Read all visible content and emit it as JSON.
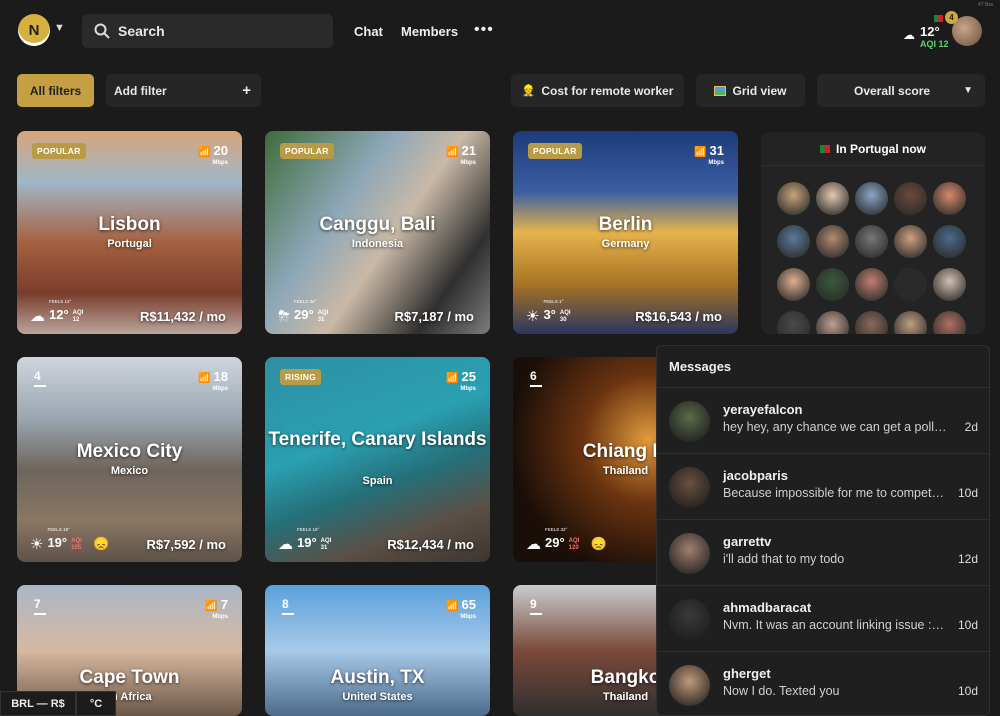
{
  "header": {
    "search_placeholder": "Search",
    "nav": [
      "Chat",
      "Members"
    ],
    "more": "•••",
    "weather": {
      "temp": "12°",
      "aqi": "AQI 12",
      "icon": "cloud-sun-icon"
    },
    "notification_count": "4",
    "sys_info": "47 Bss"
  },
  "filters": {
    "all_label": "All filters",
    "add_label": "Add filter",
    "add_icon": "+",
    "cost_label": "Cost for remote worker",
    "grid_label": "Grid view",
    "sort_label": "Overall score",
    "accent": "#c79f43"
  },
  "cities": [
    {
      "tag": "POPULAR",
      "rank": "",
      "name": "Lisbon",
      "country": "Portugal",
      "mbps": "20",
      "unit": "Mbps",
      "feels": "FEELS 12°",
      "temp": "12°",
      "aqi": "AQI 12",
      "aqi_bad": false,
      "price": "R$11,432 / mo",
      "wx": "☁"
    },
    {
      "tag": "POPULAR",
      "rank": "",
      "name": "Canggu, Bali",
      "country": "Indonesia",
      "mbps": "21",
      "unit": "Mbps",
      "feels": "FEELS 34°",
      "temp": "29°",
      "aqi": "AQI 31",
      "aqi_bad": false,
      "price": "R$7,187 / mo",
      "wx": "⛈"
    },
    {
      "tag": "POPULAR",
      "rank": "",
      "name": "Berlin",
      "country": "Germany",
      "mbps": "31",
      "unit": "Mbps",
      "feels": "FEELS 1°",
      "temp": "3°",
      "aqi": "AQI 30",
      "aqi_bad": false,
      "price": "R$16,543 / mo",
      "wx": "☀"
    },
    {
      "tag": "",
      "rank": "4",
      "name": "Mexico City",
      "country": "Mexico",
      "mbps": "18",
      "unit": "Mbps",
      "feels": "FEELS 19°",
      "temp": "19°",
      "aqi": "AQI 105",
      "aqi_bad": true,
      "price": "R$7,592 / mo",
      "wx": "☀"
    },
    {
      "tag": "RISING",
      "rank": "",
      "name": "Tenerife, Canary Islands",
      "country": "Spain",
      "mbps": "25",
      "unit": "Mbps",
      "feels": "FEELS 19°",
      "temp": "19°",
      "aqi": "AQI 31",
      "aqi_bad": false,
      "price": "R$12,434 / mo",
      "wx": "☁"
    },
    {
      "tag": "",
      "rank": "6",
      "name": "Chiang M",
      "country": "Thailand",
      "mbps": "",
      "unit": "",
      "feels": "FEELS 32°",
      "temp": "29°",
      "aqi": "AQI 120",
      "aqi_bad": true,
      "price": "R$",
      "wx": "☁"
    },
    {
      "tag": "",
      "rank": "7",
      "name": "Cape Town",
      "country": "th Africa",
      "mbps": "7",
      "unit": "Mbps",
      "feels": "",
      "temp": "",
      "aqi": "",
      "aqi_bad": false,
      "price": "",
      "wx": ""
    },
    {
      "tag": "",
      "rank": "8",
      "name": "Austin, TX",
      "country": "United States",
      "mbps": "65",
      "unit": "Mbps",
      "feels": "",
      "temp": "",
      "aqi": "",
      "aqi_bad": false,
      "price": "",
      "wx": ""
    },
    {
      "tag": "",
      "rank": "9",
      "name": "Bangko",
      "country": "Thailand",
      "mbps": "",
      "unit": "",
      "feels": "",
      "temp": "",
      "aqi": "",
      "aqi_bad": false,
      "price": "",
      "wx": ""
    }
  ],
  "portugal": {
    "title": "In Portugal now"
  },
  "messages": {
    "title": "Messages",
    "items": [
      {
        "name": "yerayefalcon",
        "text": "hey hey, any chance we can get a poll ap...",
        "time": "2d"
      },
      {
        "name": "jacobparis",
        "text": "Because impossible for me to compete ...",
        "time": "10d"
      },
      {
        "name": "garrettv",
        "text": "i'll add that to my todo",
        "time": "12d"
      },
      {
        "name": "ahmadbaracat",
        "text": "Nvm. It was an account linking issue :sw...",
        "time": "10d"
      },
      {
        "name": "gherget",
        "text": "Now I do. Texted you",
        "time": "10d"
      }
    ]
  },
  "footer": {
    "currency": "BRL — R$",
    "unit": "°C"
  }
}
